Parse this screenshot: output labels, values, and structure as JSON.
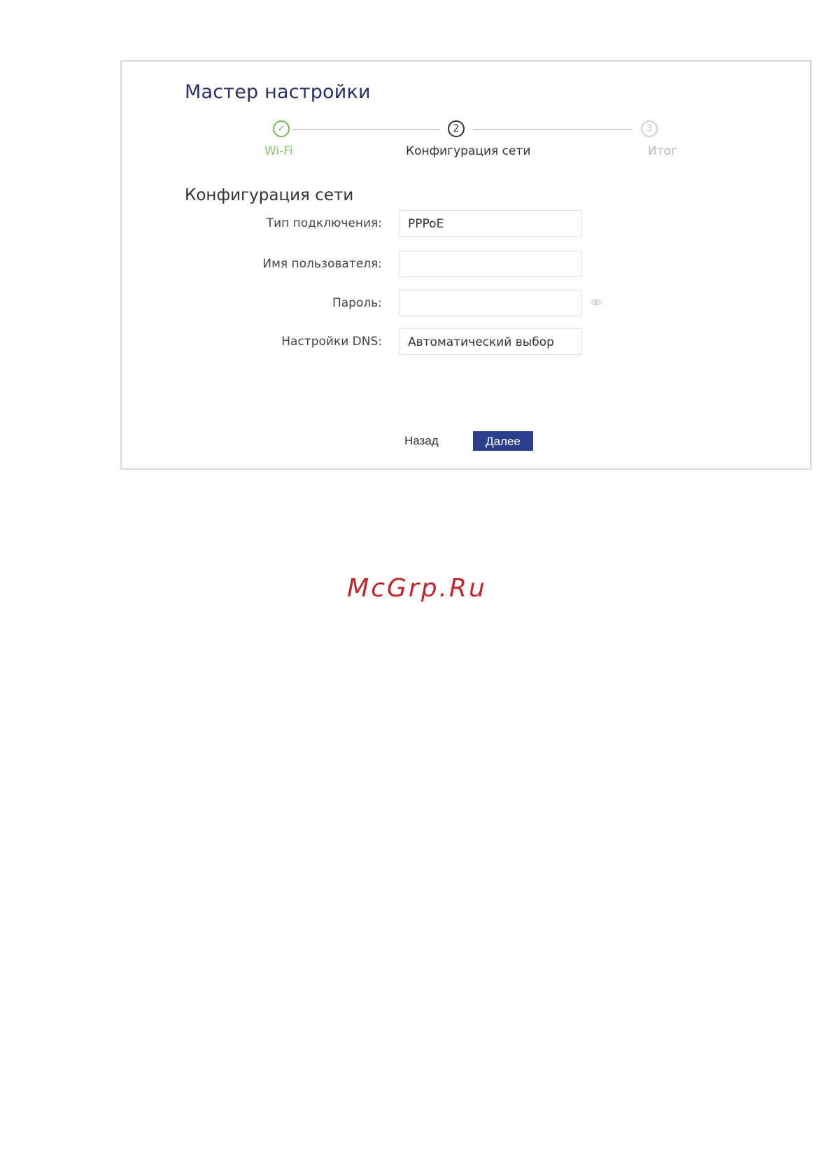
{
  "wizard": {
    "title": "Мастер настройки",
    "steps": [
      {
        "label": "Wi-Fi",
        "state": "done",
        "marker": "✓"
      },
      {
        "label": "Конфигурация сети",
        "state": "active",
        "marker": "2"
      },
      {
        "label": "Итог",
        "state": "pending",
        "marker": "3"
      }
    ]
  },
  "network": {
    "section_title": "Конфигурация сети",
    "connection_type": {
      "label": "Тип подключения:",
      "value": "PPPoE"
    },
    "username": {
      "label": "Имя пользователя:",
      "value": ""
    },
    "password": {
      "label": "Пароль:",
      "value": ""
    },
    "dns": {
      "label": "Настройки DNS:",
      "value": "Автоматический выбор"
    }
  },
  "buttons": {
    "back": "Назад",
    "next": "Далее"
  },
  "watermark": "McGrp.Ru",
  "colors": {
    "title": "#2b2f64",
    "step_done": "#7ab55c",
    "primary_button": "#2b3f8c",
    "watermark": "#c1272d"
  },
  "icons": {
    "step_done": "check-circle-icon",
    "password_toggle": "eye-icon"
  }
}
